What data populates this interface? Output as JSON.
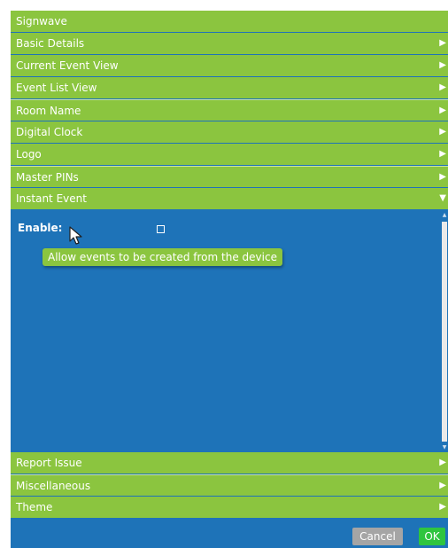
{
  "title": "Signwave",
  "sections_top": [
    {
      "label": "Basic Details",
      "arrow": "▶"
    },
    {
      "label": "Current Event View",
      "arrow": "▶"
    },
    {
      "label": "Event List View",
      "arrow": "▶"
    },
    {
      "label": "Room Name",
      "arrow": "▶"
    },
    {
      "label": "Digital Clock",
      "arrow": "▶"
    },
    {
      "label": "Logo",
      "arrow": "▶"
    },
    {
      "label": "Master PINs",
      "arrow": "▶"
    },
    {
      "label": "Instant Event",
      "arrow": "▼"
    }
  ],
  "instant_event": {
    "enable_label": "Enable:",
    "enable_checked": false,
    "tooltip": "Allow events to be created from the device"
  },
  "sections_bottom": [
    {
      "label": "Report Issue",
      "arrow": "▶"
    },
    {
      "label": "Miscellaneous",
      "arrow": "▶"
    },
    {
      "label": "Theme",
      "arrow": "▶"
    }
  ],
  "footer": {
    "cancel_label": "Cancel",
    "ok_label": "OK"
  },
  "colors": {
    "accent_green": "#8bc53f",
    "panel_blue": "#1e73b8",
    "ok_green": "#2fc53f",
    "cancel_gray": "#a5a5a5"
  },
  "icons": {
    "collapsed": "triangle-right-icon",
    "expanded": "triangle-down-icon",
    "cursor": "mouse-pointer-icon"
  }
}
